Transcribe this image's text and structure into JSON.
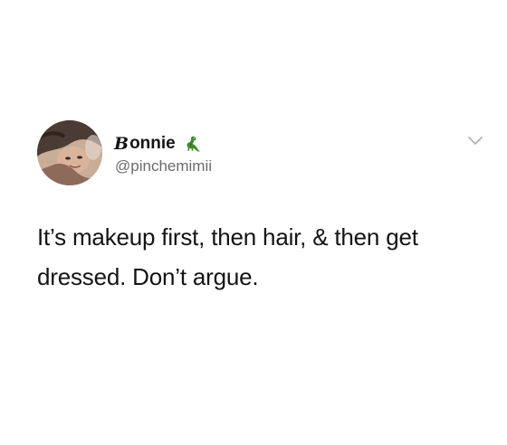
{
  "author": {
    "display_name_initial": "B",
    "display_name_rest": "onnie",
    "name_emoji": "dinosaur-icon",
    "handle": "@pinchemimii",
    "avatar": "profile-photo"
  },
  "menu": {
    "icon": "chevron-down-icon"
  },
  "tweet": {
    "text": "It’s makeup first, then hair, & then get dressed. Don’t argue."
  },
  "colors": {
    "background": "#ffffff",
    "text": "#141414",
    "handle": "#6b6b6b",
    "dino": "#3f8a2a"
  }
}
